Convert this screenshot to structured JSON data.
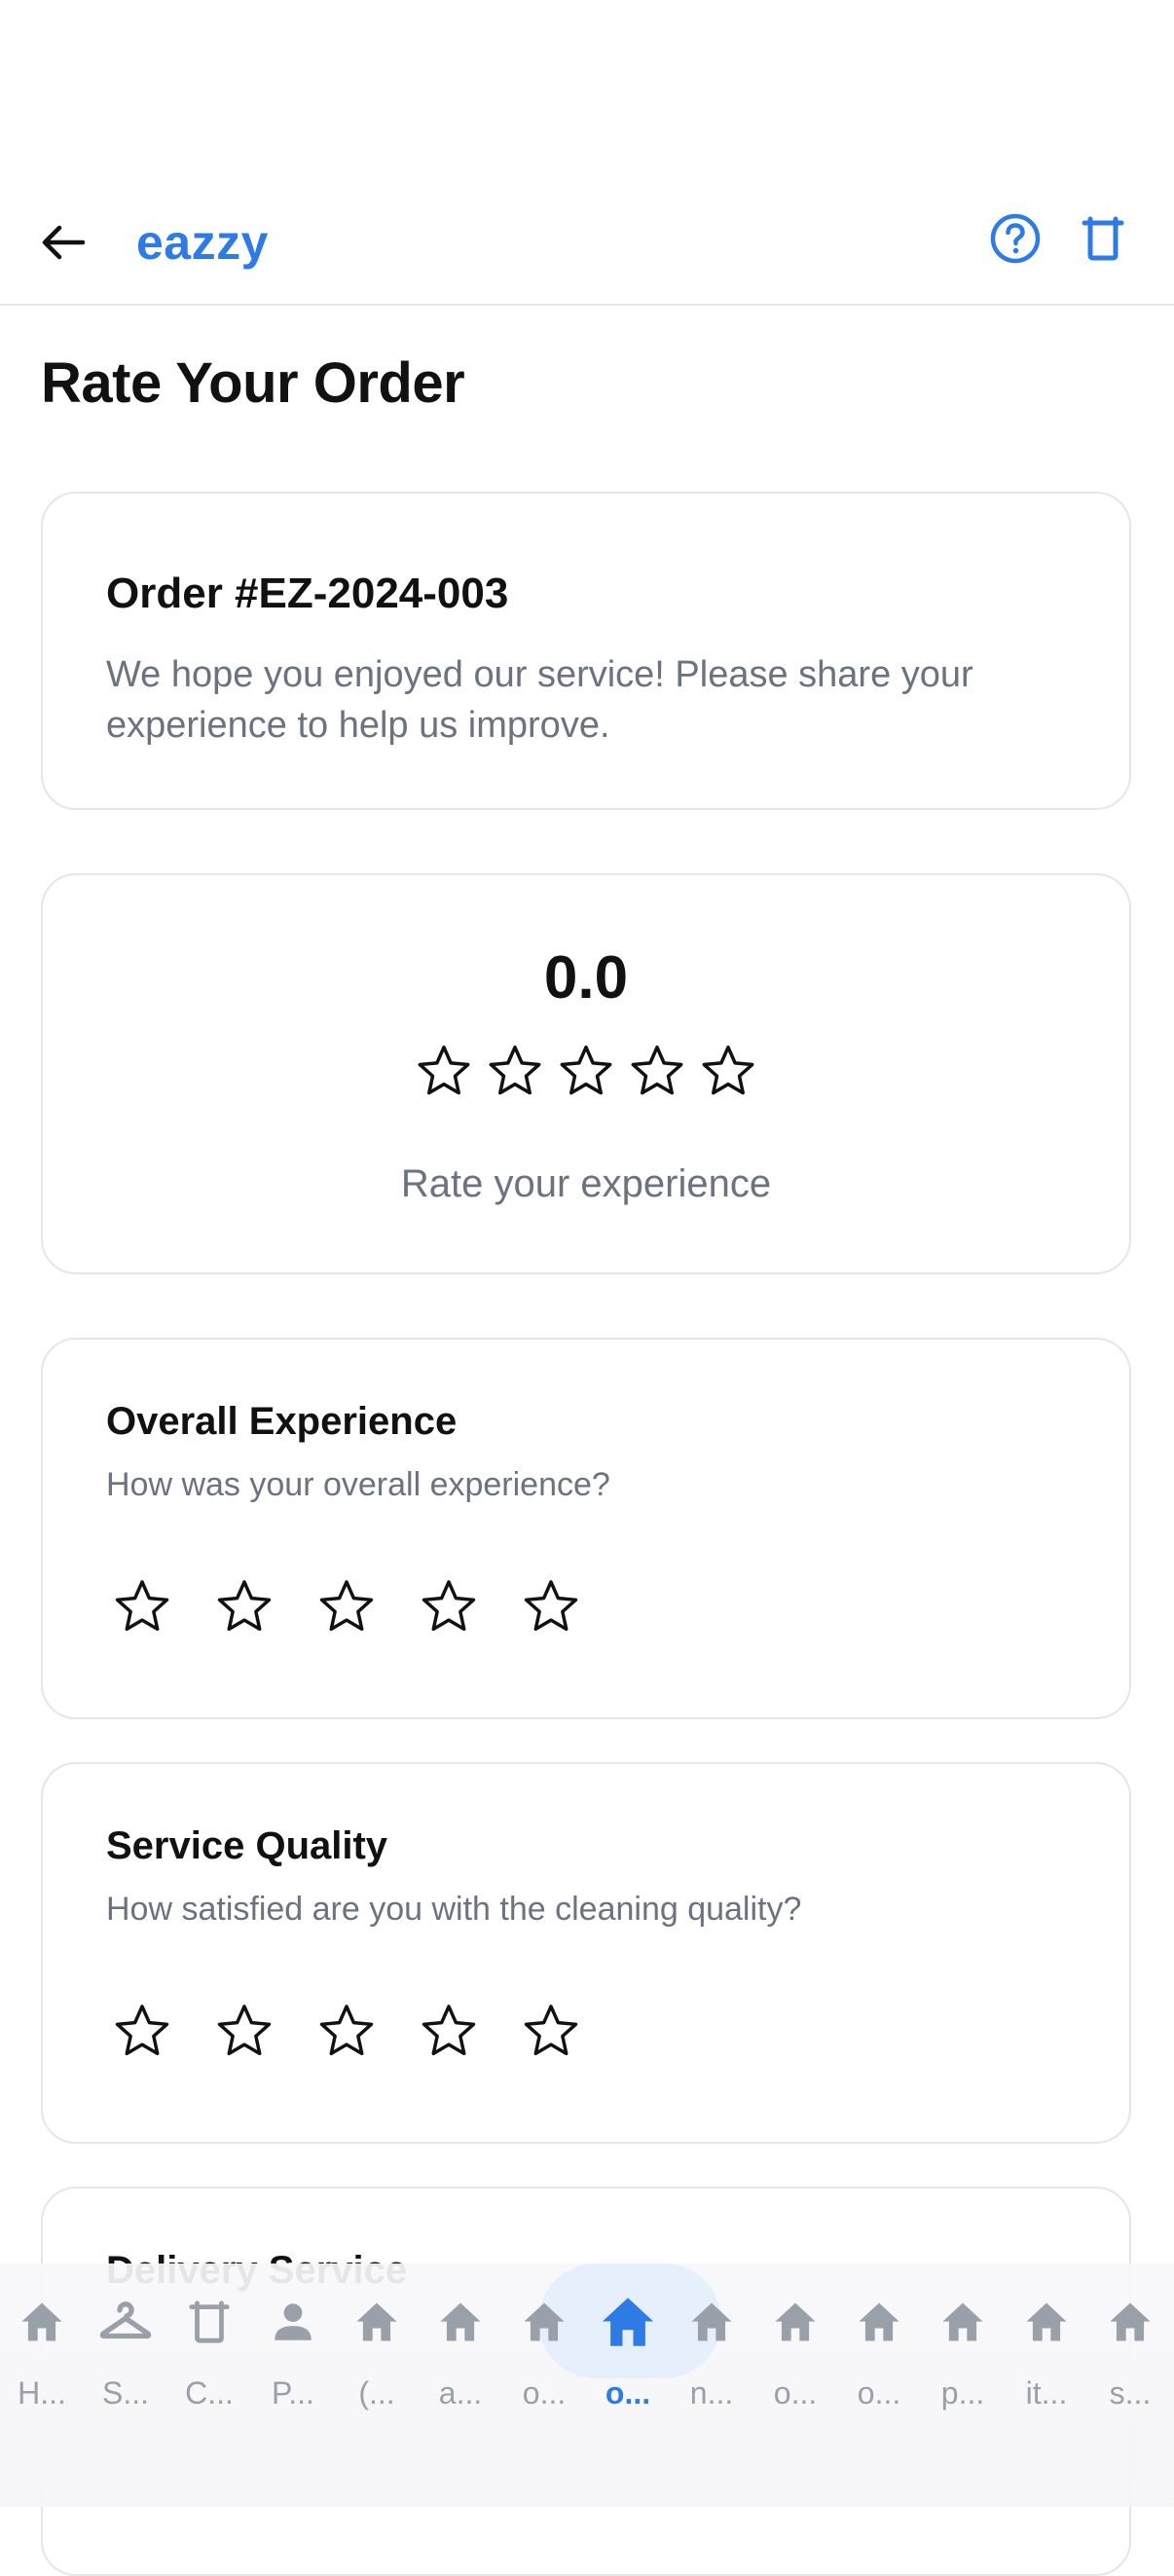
{
  "header": {
    "brand": "eazzy"
  },
  "page": {
    "title": "Rate Your Order"
  },
  "order": {
    "title": "Order #EZ-2024-003",
    "description": "We hope you enjoyed our service! Please share your experience to help us improve."
  },
  "overall": {
    "score": "0.0",
    "rating": 0,
    "max_rating": 5,
    "hint": "Rate your experience"
  },
  "categories": [
    {
      "title": "Overall Experience",
      "subtitle": "How was your overall experience?",
      "rating": 0
    },
    {
      "title": "Service Quality",
      "subtitle": "How satisfied are you with the cleaning quality?",
      "rating": 0
    },
    {
      "title": "Delivery Service",
      "subtitle": "",
      "rating": 0
    }
  ],
  "tabs": [
    {
      "label": "H...",
      "icon": "home-icon"
    },
    {
      "label": "S...",
      "icon": "hanger-icon"
    },
    {
      "label": "C...",
      "icon": "bucket-icon"
    },
    {
      "label": "P...",
      "icon": "person-icon"
    },
    {
      "label": "(...",
      "icon": "home-icon"
    },
    {
      "label": "a...",
      "icon": "home-icon"
    },
    {
      "label": "o...",
      "icon": "home-icon"
    },
    {
      "label": "o...",
      "icon": "home-icon",
      "active": true
    },
    {
      "label": "n...",
      "icon": "home-icon"
    },
    {
      "label": "o...",
      "icon": "home-icon"
    },
    {
      "label": "o...",
      "icon": "home-icon"
    },
    {
      "label": "p...",
      "icon": "home-icon"
    },
    {
      "label": "it...",
      "icon": "home-icon"
    },
    {
      "label": "s...",
      "icon": "home-icon"
    }
  ],
  "colors": {
    "accent": "#2f7be5",
    "muted_text": "#6b7280",
    "tab_inactive": "#9aa0aa",
    "border": "#e4e6ea"
  }
}
